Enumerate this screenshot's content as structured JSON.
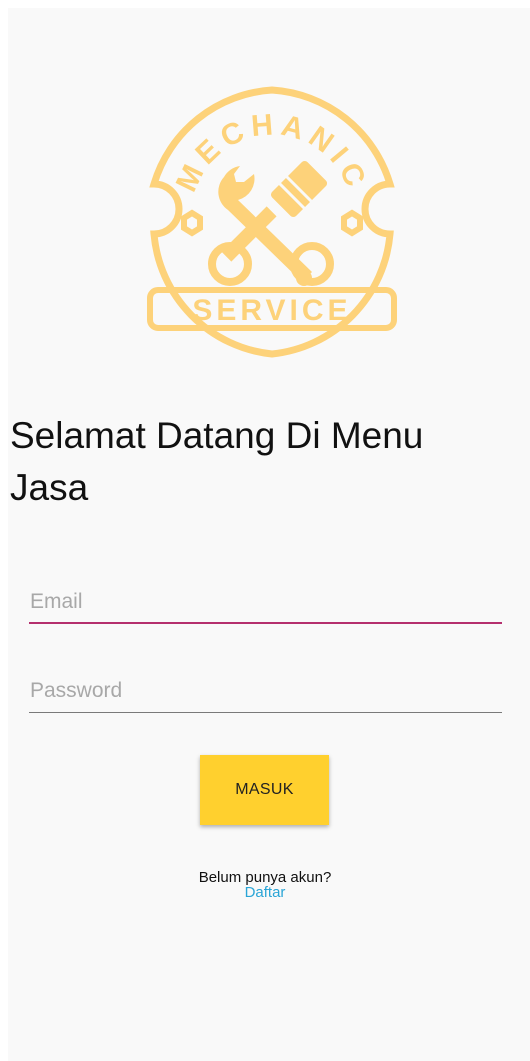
{
  "logo": {
    "top_text": "MECHANIC",
    "bottom_text": "SERVICE",
    "color": "#fdd27a"
  },
  "welcome": {
    "line1": "Selamat Datang Di Menu",
    "line2": "Jasa"
  },
  "form": {
    "email_placeholder": "Email",
    "email_value": "",
    "password_placeholder": "Password",
    "password_value": "",
    "submit_label": "MASUK"
  },
  "signup": {
    "question": "Belum punya akun?",
    "link_label": "Daftar"
  },
  "colors": {
    "accent_underline": "#b5306e",
    "button": "#ffd02e",
    "link": "#2aa5d6",
    "background": "#f9f9f9"
  }
}
